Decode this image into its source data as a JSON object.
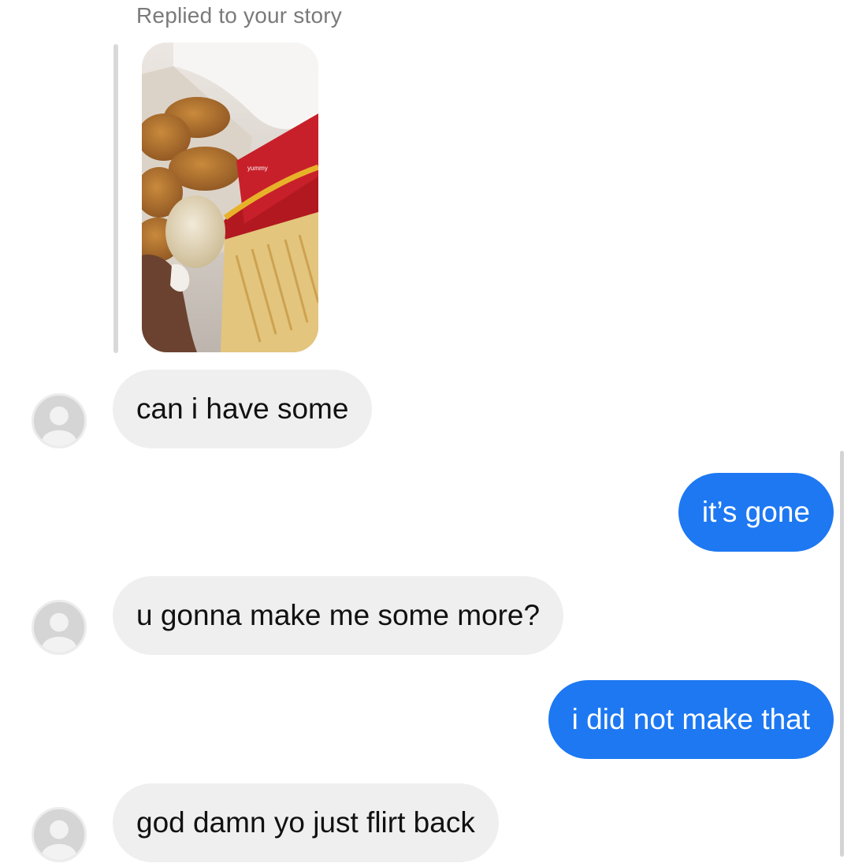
{
  "story_reply": {
    "caption": "Replied to your story",
    "thumbnail_sticker_text": "yummy"
  },
  "messages": [
    {
      "direction": "incoming",
      "text": "can i have some"
    },
    {
      "direction": "outgoing",
      "text": "it’s gone"
    },
    {
      "direction": "incoming",
      "text": "u gonna make me some more?"
    },
    {
      "direction": "outgoing",
      "text": "i did not make that"
    },
    {
      "direction": "incoming",
      "text": "god damn yo just flirt back"
    }
  ],
  "colors": {
    "incoming_bubble": "#efefef",
    "outgoing_bubble": "#1d78f2",
    "caption_text": "#7a7a7a"
  },
  "icons": {
    "avatar": "default-profile-icon"
  }
}
